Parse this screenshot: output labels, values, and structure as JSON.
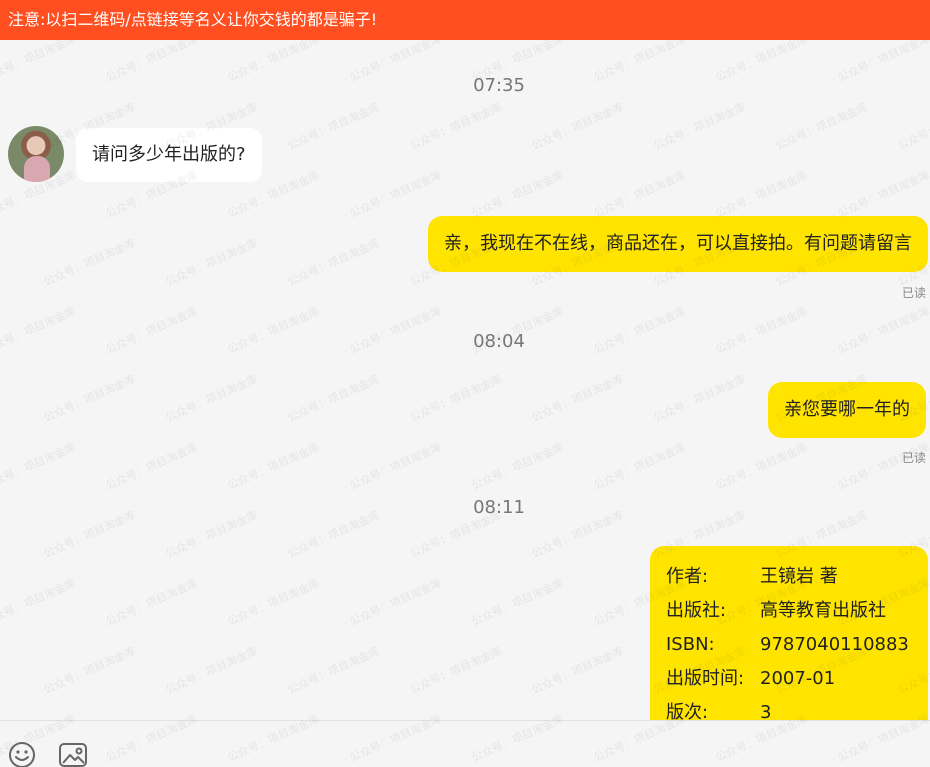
{
  "warning": {
    "text": "注意:以扫二维码/点链接等名义让你交钱的都是骗子!"
  },
  "watermark": "公众号：项目淘金库",
  "messages": {
    "time_1": "07:35",
    "incoming_1": "请问多少年出版的?",
    "outgoing_1": "亲，我现在不在线，商品还在，可以直接拍。有问题请留言",
    "read_1": "已读",
    "time_2": "08:04",
    "outgoing_2": "亲您要哪一年的",
    "read_2": "已读",
    "time_3": "08:11"
  },
  "book_card": {
    "rows": [
      {
        "key": "作者:",
        "value": "王镜岩 著"
      },
      {
        "key": "出版社:",
        "value": "高等教育出版社"
      },
      {
        "key": "ISBN:",
        "value": "9787040110883"
      },
      {
        "key": "出版时间:",
        "value": "2007-01"
      },
      {
        "key": "版次:",
        "value": "3"
      }
    ]
  },
  "toolbar": {
    "emoji_icon": "emoji-icon",
    "image_icon": "image-icon"
  },
  "colors": {
    "warning_bg": "#ff4e1f",
    "outgoing_bubble": "#ffe400",
    "incoming_bubble": "#ffffff",
    "background": "#f5f5f5"
  }
}
